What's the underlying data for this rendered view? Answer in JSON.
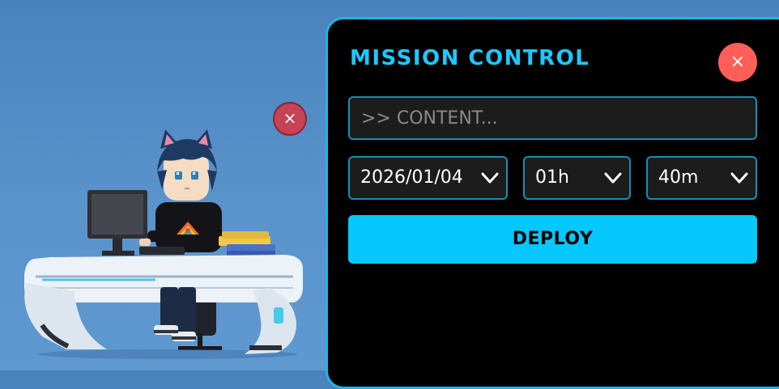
{
  "pet": {
    "close_glyph": "×",
    "character": "pixel-art-coder-at-desk"
  },
  "panel": {
    "title": "MISSION CONTROL",
    "close_glyph": "×",
    "content_placeholder": ">> CONTENT...",
    "content_value": "",
    "date_select": {
      "value": "2026/01/04"
    },
    "hour_select": {
      "value": "01h"
    },
    "minute_select": {
      "value": "40m"
    },
    "deploy_label": "DEPLOY"
  },
  "colors": {
    "desktop": "#4a82bd",
    "panel_bg": "#000000",
    "panel_border": "#1fb6e6",
    "accent": "#05c8ff",
    "title": "#1ec8ff",
    "close_panel": "#ff5f57",
    "close_pet": "#c64355"
  }
}
